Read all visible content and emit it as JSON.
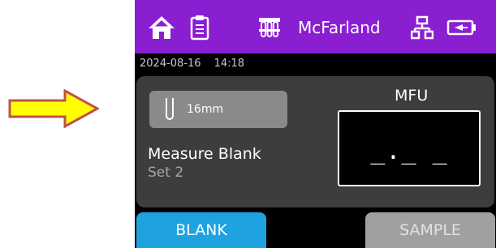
{
  "header": {
    "title": "McFarland",
    "icons": [
      "home-icon",
      "clipboard-icon",
      "test-tube-rack-icon",
      "network-icon",
      "battery-icon"
    ]
  },
  "status": {
    "date": "2024-08-16",
    "time": "14:18"
  },
  "tube": {
    "label": "16mm",
    "icon": "test-tube-icon"
  },
  "measure": {
    "title": "Measure Blank",
    "set": "Set 2"
  },
  "mfu": {
    "label": "MFU",
    "value": "_._ _"
  },
  "buttons": {
    "blank": "BLANK",
    "sample": "SAMPLE"
  },
  "colors": {
    "header": "#8a1ed1",
    "panel": "#3d3d3d",
    "blank_button": "#1fa3e0",
    "sample_button_disabled": "#a0a0a0",
    "arrow_fill": "#ffff00",
    "arrow_outline": "#c0504d"
  }
}
